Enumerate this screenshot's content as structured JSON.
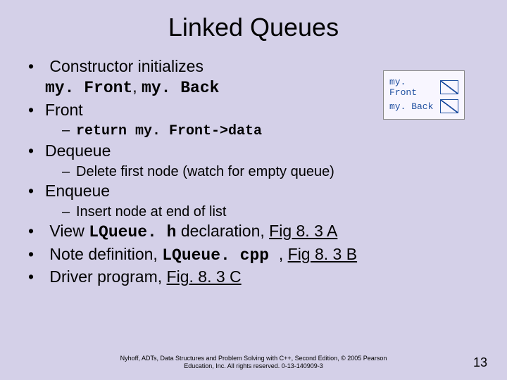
{
  "title": "Linked Queues",
  "bullets": {
    "b1_text": "Constructor initializes",
    "b1_code1": "my. Front",
    "b1_sep": ", ",
    "b1_code2": "my. Back",
    "b2": "Front",
    "b2_sub_code": "return my. Front->data",
    "b3": "Dequeue",
    "b3_sub": "Delete first node (watch for empty queue)",
    "b4": "Enqueue",
    "b4_sub": "Insert node at end of list",
    "b5_pre": "View ",
    "b5_code": "LQueue. h",
    "b5_mid": " declaration, ",
    "b5_link": "Fig 8. 3 A",
    "b6_pre": "Note definition, ",
    "b6_code": "LQueue. cpp ",
    "b6_mid": ", ",
    "b6_link": "Fig 8. 3 B",
    "b7_pre": "Driver program, ",
    "b7_link": "Fig. 8. 3 C"
  },
  "diagram": {
    "row1": "my. Front",
    "row2": "my. Back"
  },
  "footer_line1": "Nyhoff, ADTs, Data Structures and Problem Solving with C++, Second Edition, © 2005 Pearson",
  "footer_line2": "Education, Inc. All rights reserved. 0-13-140909-3",
  "page_number": "13"
}
